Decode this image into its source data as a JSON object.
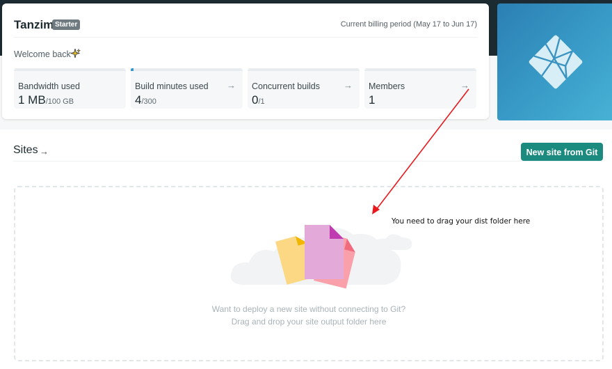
{
  "account": {
    "name": "Tanzim",
    "plan_badge": "Starter",
    "billing_period": "Current billing period (May 17 to Jun 17)",
    "welcome": "Welcome back"
  },
  "stats": [
    {
      "label": "Bandwidth used",
      "value": "1 MB",
      "unit": "/100 GB"
    },
    {
      "label": "Build minutes used",
      "value": "4",
      "unit": "/300",
      "arrow": "→"
    },
    {
      "label": "Concurrent builds",
      "value": "0",
      "unit": "/1",
      "arrow": "→"
    },
    {
      "label": "Members",
      "value": "1",
      "unit": "",
      "arrow": "→"
    }
  ],
  "build_minutes_progress": 0.013,
  "sites": {
    "title": "Sites",
    "title_arrow": "→",
    "new_site_button": "New site from Git"
  },
  "dropzone": {
    "line1": "Want to deploy a new site without connecting to Git?",
    "line2": "Drag and drop your site output folder here"
  },
  "annotation": {
    "text": "You need to drag your dist folder here",
    "color": "#e8191d"
  },
  "colors": {
    "accent": "#1b8a7f",
    "header_dark": "#1c2b31",
    "logo_blue": "#2b7fb3"
  },
  "icons": [
    "sparkle-icon",
    "netlify-logo",
    "arrow-right-icon",
    "files-illustration"
  ]
}
